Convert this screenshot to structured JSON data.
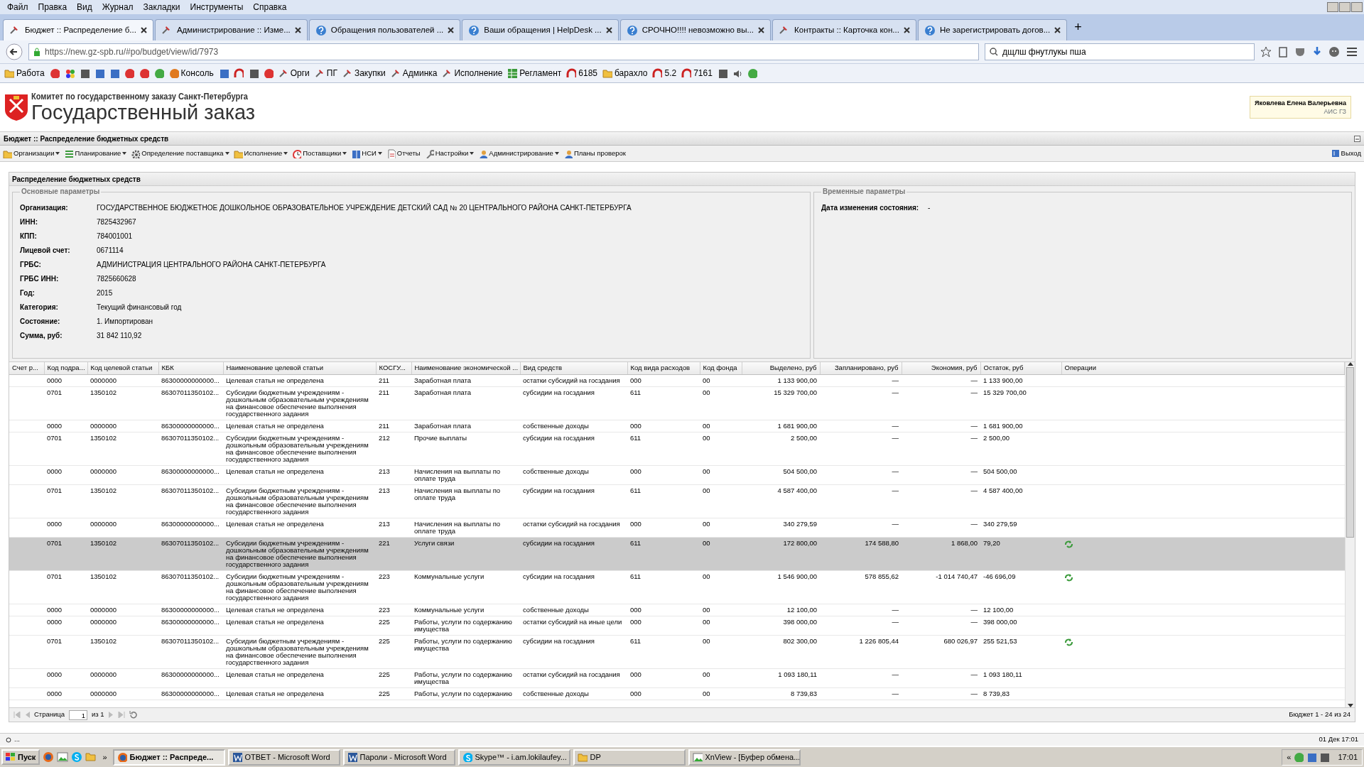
{
  "menu_bar": [
    "Файл",
    "Правка",
    "Вид",
    "Журнал",
    "Закладки",
    "Инструменты",
    "Справка"
  ],
  "tabs": [
    {
      "title": "Бюджет :: Распределение б...",
      "kind": "tool",
      "selected": true
    },
    {
      "title": "Администрирование :: Изме...",
      "kind": "tool",
      "selected": false
    },
    {
      "title": "Обращения пользователей ...",
      "kind": "help",
      "selected": false
    },
    {
      "title": "Ваши обращения | HelpDesk ...",
      "kind": "help",
      "selected": false
    },
    {
      "title": "СРОЧНО!!!! невозможно вы...",
      "kind": "help",
      "selected": false
    },
    {
      "title": "Контракты :: Карточка кон...",
      "kind": "tool",
      "selected": false
    },
    {
      "title": "Не зарегистрировать догов...",
      "kind": "help",
      "selected": false
    }
  ],
  "new_tab": "+",
  "address_bar": {
    "url": "https://new.gz-spb.ru/#po/budget/view/id/7973"
  },
  "search": {
    "value": "дщлш фнутлукы пша"
  },
  "bookmarks": [
    {
      "label": "Работа",
      "kind": "folder"
    },
    {
      "kind": "red"
    },
    {
      "kind": "multi"
    },
    {
      "kind": "dark"
    },
    {
      "kind": "blue"
    },
    {
      "kind": "blue"
    },
    {
      "kind": "red"
    },
    {
      "kind": "red"
    },
    {
      "kind": "green"
    },
    {
      "label": "Консоль",
      "kind": "orange"
    },
    {
      "kind": "blue"
    },
    {
      "kind": "arch"
    },
    {
      "kind": "dark"
    },
    {
      "kind": "red"
    },
    {
      "label": "Орги",
      "kind": "tool"
    },
    {
      "label": "ПГ",
      "kind": "tool"
    },
    {
      "label": "Закупки",
      "kind": "tool"
    },
    {
      "label": "Админка",
      "kind": "tool"
    },
    {
      "label": "Исполнение",
      "kind": "tool"
    },
    {
      "label": "Регламент",
      "kind": "grid"
    },
    {
      "label": "6185",
      "kind": "arch"
    },
    {
      "label": "барахло",
      "kind": "folder"
    },
    {
      "label": "5.2",
      "kind": "arch"
    },
    {
      "label": "7161",
      "kind": "arch"
    },
    {
      "kind": "dark"
    },
    {
      "kind": "speaker"
    },
    {
      "kind": "green"
    }
  ],
  "header": {
    "org": "Комитет по государственному заказу Санкт-Петербурга",
    "title": "Государственный заказ",
    "user": "Яковлева Елена Валерьевна",
    "system": "АИС ГЗ"
  },
  "section_title": "Бюджет :: Распределение бюджетных средств",
  "toolbar": {
    "items": [
      {
        "label": "Организации",
        "kind": "folder",
        "dropdown": true
      },
      {
        "label": "Планирование",
        "kind": "list",
        "dropdown": true
      },
      {
        "label": "Определение поставщика",
        "kind": "gear",
        "dropdown": true
      },
      {
        "label": "Исполнение",
        "kind": "folder",
        "dropdown": true
      },
      {
        "label": "Поставщики",
        "kind": "clock",
        "dropdown": true
      },
      {
        "label": "НСИ",
        "kind": "book",
        "dropdown": true
      },
      {
        "label": "Отчеты",
        "kind": "document",
        "dropdown": false
      },
      {
        "label": "Настройки",
        "kind": "wrench",
        "dropdown": true
      },
      {
        "label": "Администрирование",
        "kind": "person",
        "dropdown": true
      },
      {
        "label": "Планы проверок",
        "kind": "person",
        "dropdown": false
      }
    ],
    "exit": "Выход"
  },
  "panel_title": "Распределение бюджетных средств",
  "main_params": {
    "legend": "Основные параметры",
    "fields": [
      {
        "label": "Организация:",
        "value": "ГОСУДАРСТВЕННОЕ БЮДЖЕТНОЕ ДОШКОЛЬНОЕ ОБРАЗОВАТЕЛЬНОЕ УЧРЕЖДЕНИЕ ДЕТСКИЙ САД № 20 ЦЕНТРАЛЬНОГО РАЙОНА САНКТ-ПЕТЕРБУРГА"
      },
      {
        "label": "ИНН:",
        "value": "7825432967"
      },
      {
        "label": "КПП:",
        "value": "784001001"
      },
      {
        "label": "Лицевой счет:",
        "value": "0671114"
      },
      {
        "label": "ГРБС:",
        "value": "АДМИНИСТРАЦИЯ ЦЕНТРАЛЬНОГО РАЙОНА САНКТ-ПЕТЕРБУРГА"
      },
      {
        "label": "ГРБС ИНН:",
        "value": "7825660628"
      },
      {
        "label": "Год:",
        "value": "2015"
      },
      {
        "label": "Категория:",
        "value": "Текущий финансовый год"
      },
      {
        "label": "Состояние:",
        "value": "1. Импортирован"
      },
      {
        "label": "Сумма, руб:",
        "value": "31 842 110,92"
      }
    ]
  },
  "time_params": {
    "legend": "Временные параметры",
    "fields": [
      {
        "label": "Дата изменения состояния:",
        "value": "-"
      }
    ]
  },
  "table": {
    "columns": [
      "Счет р...",
      "Код подра...",
      "Код целевой статьи",
      "КБК",
      "Наименование целевой статьи",
      "КОСГУ...",
      "Наименование экономической ...",
      "Вид средств",
      "Код вида расходов",
      "Код фонда",
      "Выделено, руб",
      "Запланировано, руб",
      "Экономия, руб",
      "Остаток, руб",
      "Операции"
    ],
    "rows": [
      {
        "selected": false,
        "has_action": false,
        "cells": [
          "",
          "0000",
          "0000000",
          "86300000000000...",
          "Целевая статья не определена",
          "211",
          "Заработная плата",
          "остатки субсидий на госздания",
          "000",
          "00",
          "1 133 900,00",
          "—",
          "—",
          "1 133 900,00"
        ]
      },
      {
        "selected": false,
        "has_action": false,
        "cells": [
          "",
          "0701",
          "1350102",
          "86307011350102...",
          "Субсидии бюджетным учреждениям - дошкольным образовательным учреждениям на финансовое обеспечение выполнения государственного задания",
          "211",
          "Заработная плата",
          "субсидии на госздания",
          "611",
          "00",
          "15 329 700,00",
          "—",
          "—",
          "15 329 700,00"
        ]
      },
      {
        "selected": false,
        "has_action": false,
        "cells": [
          "",
          "0000",
          "0000000",
          "86300000000000...",
          "Целевая статья не определена",
          "211",
          "Заработная плата",
          "собственные доходы",
          "000",
          "00",
          "1 681 900,00",
          "—",
          "—",
          "1 681 900,00"
        ]
      },
      {
        "selected": false,
        "has_action": false,
        "cells": [
          "",
          "0701",
          "1350102",
          "86307011350102...",
          "Субсидии бюджетным учреждениям - дошкольным образовательным учреждениям на финансовое обеспечение выполнения государственного задания",
          "212",
          "Прочие выплаты",
          "субсидии на госздания",
          "611",
          "00",
          "2 500,00",
          "—",
          "—",
          "2 500,00"
        ]
      },
      {
        "selected": false,
        "has_action": false,
        "cells": [
          "",
          "0000",
          "0000000",
          "86300000000000...",
          "Целевая статья не определена",
          "213",
          "Начисления на выплаты по оплате труда",
          "собственные доходы",
          "000",
          "00",
          "504 500,00",
          "—",
          "—",
          "504 500,00"
        ]
      },
      {
        "selected": false,
        "has_action": false,
        "cells": [
          "",
          "0701",
          "1350102",
          "86307011350102...",
          "Субсидии бюджетным учреждениям - дошкольным образовательным учреждениям на финансовое обеспечение выполнения государственного задания",
          "213",
          "Начисления на выплаты по оплате труда",
          "субсидии на госздания",
          "611",
          "00",
          "4 587 400,00",
          "—",
          "—",
          "4 587 400,00"
        ]
      },
      {
        "selected": false,
        "has_action": false,
        "cells": [
          "",
          "0000",
          "0000000",
          "86300000000000...",
          "Целевая статья не определена",
          "213",
          "Начисления на выплаты по оплате труда",
          "остатки субсидий на госздания",
          "000",
          "00",
          "340 279,59",
          "—",
          "—",
          "340 279,59"
        ]
      },
      {
        "selected": true,
        "has_action": true,
        "cells": [
          "",
          "0701",
          "1350102",
          "86307011350102...",
          "Субсидии бюджетным учреждениям - дошкольным образовательным учреждениям на финансовое обеспечение выполнения государственного задания",
          "221",
          "Услуги связи",
          "субсидии на госздания",
          "611",
          "00",
          "172 800,00",
          "174 588,80",
          "1 868,00",
          "79,20"
        ]
      },
      {
        "selected": false,
        "has_action": true,
        "cells": [
          "",
          "0701",
          "1350102",
          "86307011350102...",
          "Субсидии бюджетным учреждениям - дошкольным образовательным учреждениям на финансовое обеспечение выполнения государственного задания",
          "223",
          "Коммунальные услуги",
          "субсидии на госздания",
          "611",
          "00",
          "1 546 900,00",
          "578 855,62",
          "-1 014 740,47",
          "-46 696,09"
        ]
      },
      {
        "selected": false,
        "has_action": false,
        "cells": [
          "",
          "0000",
          "0000000",
          "86300000000000...",
          "Целевая статья не определена",
          "223",
          "Коммунальные услуги",
          "собственные доходы",
          "000",
          "00",
          "12 100,00",
          "—",
          "—",
          "12 100,00"
        ]
      },
      {
        "selected": false,
        "has_action": false,
        "cells": [
          "",
          "0000",
          "0000000",
          "86300000000000...",
          "Целевая статья не определена",
          "225",
          "Работы, услуги по содержанию имущества",
          "остатки субсидий на иные цели",
          "000",
          "00",
          "398 000,00",
          "—",
          "—",
          "398 000,00"
        ]
      },
      {
        "selected": false,
        "has_action": true,
        "cells": [
          "",
          "0701",
          "1350102",
          "86307011350102...",
          "Субсидии бюджетным учреждениям - дошкольным образовательным учреждениям на финансовое обеспечение выполнения государственного задания",
          "225",
          "Работы, услуги по содержанию имущества",
          "субсидии на госздания",
          "611",
          "00",
          "802 300,00",
          "1 226 805,44",
          "680 026,97",
          "255 521,53"
        ]
      },
      {
        "selected": false,
        "has_action": false,
        "cells": [
          "",
          "0000",
          "0000000",
          "86300000000000...",
          "Целевая статья не определена",
          "225",
          "Работы, услуги по содержанию имущества",
          "остатки субсидий на госздания",
          "000",
          "00",
          "1 093 180,11",
          "—",
          "—",
          "1 093 180,11"
        ]
      },
      {
        "selected": false,
        "has_action": false,
        "cells": [
          "",
          "0000",
          "0000000",
          "86300000000000...",
          "Целевая статья не определена",
          "225",
          "Работы, услуги по содержанию",
          "собственные доходы",
          "000",
          "00",
          "8 739,83",
          "—",
          "—",
          "8 739,83"
        ]
      }
    ]
  },
  "pager": {
    "label": "Страница",
    "page": "1",
    "of": "из 1",
    "summary": "Бюджет 1 - 24 из 24"
  },
  "status_bar": {
    "left": "...",
    "right": "01 Дек 17:01"
  },
  "taskbar": {
    "start": "Пуск",
    "more": "»",
    "tasks": [
      {
        "title": "Бюджет :: Распреде...",
        "kind": "browser",
        "selected": true
      },
      {
        "title": "ОТВЕТ - Microsoft Word",
        "kind": "word",
        "selected": false
      },
      {
        "title": "Пароли - Microsoft Word",
        "kind": "word",
        "selected": false
      },
      {
        "title": "Skype™ - i.am.lokilaufey...",
        "kind": "skype",
        "selected": false
      },
      {
        "title": "DP",
        "kind": "folder",
        "selected": false
      },
      {
        "title": "XnView - [Буфер обмена...",
        "kind": "viewer",
        "selected": false
      }
    ],
    "tray_expand": "«",
    "clock": "17:01"
  }
}
